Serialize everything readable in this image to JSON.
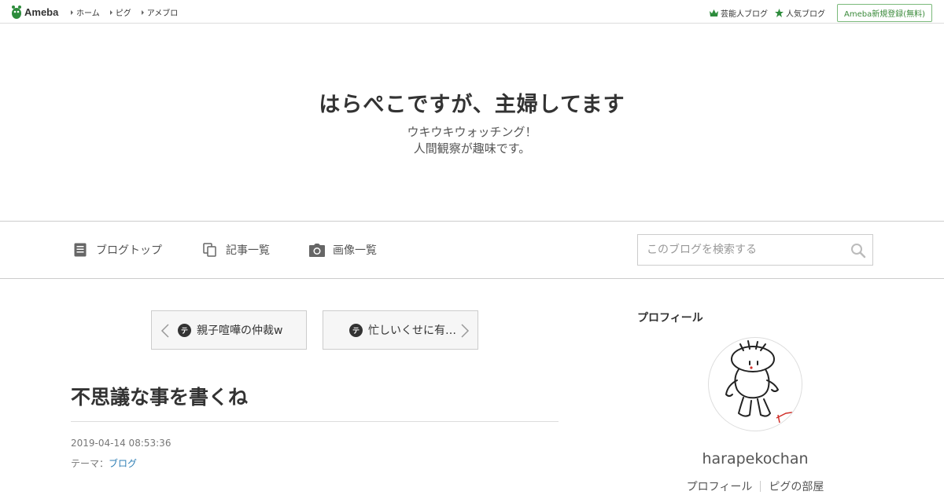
{
  "topbar": {
    "logo_text": "Ameba",
    "nav": [
      {
        "label": "ホーム"
      },
      {
        "label": "ピグ"
      },
      {
        "label": "アメブロ"
      }
    ],
    "celebrity_blog": "芸能人ブログ",
    "popular_blog": "人気ブログ",
    "register": "Ameba新規登録(無料)"
  },
  "blog": {
    "title": "はらぺこですが、主婦してます",
    "description_line1": "ウキウキウォッチング！",
    "description_line2": "人間観察が趣味です。"
  },
  "nav": {
    "top": "ブログトップ",
    "entries": "記事一覧",
    "images": "画像一覧",
    "search_placeholder": "このブログを検索する"
  },
  "pager": {
    "prev": "親子喧嘩の仲裁w",
    "next": "忙しいくせに有…",
    "theme_badge": "テ"
  },
  "article": {
    "title": "不思議な事を書くね",
    "date": "2019-04-14 08:53:36",
    "theme_label": "テーマ：",
    "theme_value": "ブログ"
  },
  "sidebar": {
    "heading": "プロフィール",
    "username": "harapekochan",
    "profile_link": "プロフィール",
    "pig_room_link": "ピグの部屋"
  },
  "colors": {
    "ameba_green": "#2d8c3c",
    "link_blue": "#2f7fb5"
  }
}
